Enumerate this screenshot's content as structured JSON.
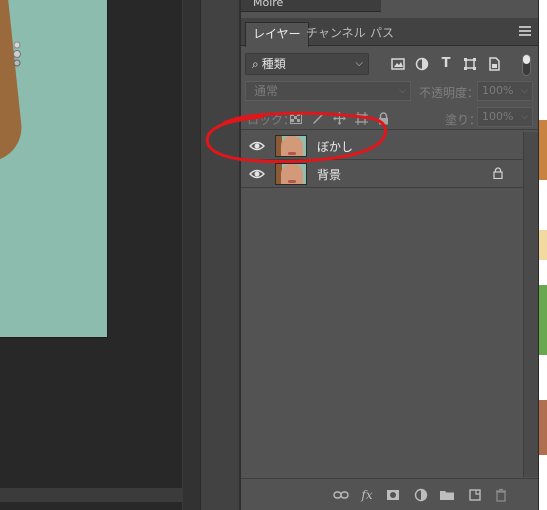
{
  "top_panel_label": "Moiré",
  "tabs": [
    {
      "label": "レイヤー",
      "active": true
    },
    {
      "label": "チャンネル",
      "active": false
    },
    {
      "label": "パス",
      "active": false
    }
  ],
  "filter": {
    "kind_label": "種類",
    "icons": [
      "image-filter-icon",
      "adjustment-filter-icon",
      "type-filter-icon",
      "shape-filter-icon",
      "smart-object-filter-icon"
    ]
  },
  "blend": {
    "mode": "通常",
    "opacity_label": "不透明度：",
    "opacity_value": "100%"
  },
  "lock": {
    "label": "ロック：",
    "fill_label": "塗り：",
    "fill_value": "100%"
  },
  "layers": [
    {
      "name": "ぼかし",
      "visible": true,
      "locked": false
    },
    {
      "name": "背景",
      "visible": true,
      "locked": true
    }
  ],
  "annotation_color": "#e0161b",
  "canvas_bg_color": "#8bbcae"
}
